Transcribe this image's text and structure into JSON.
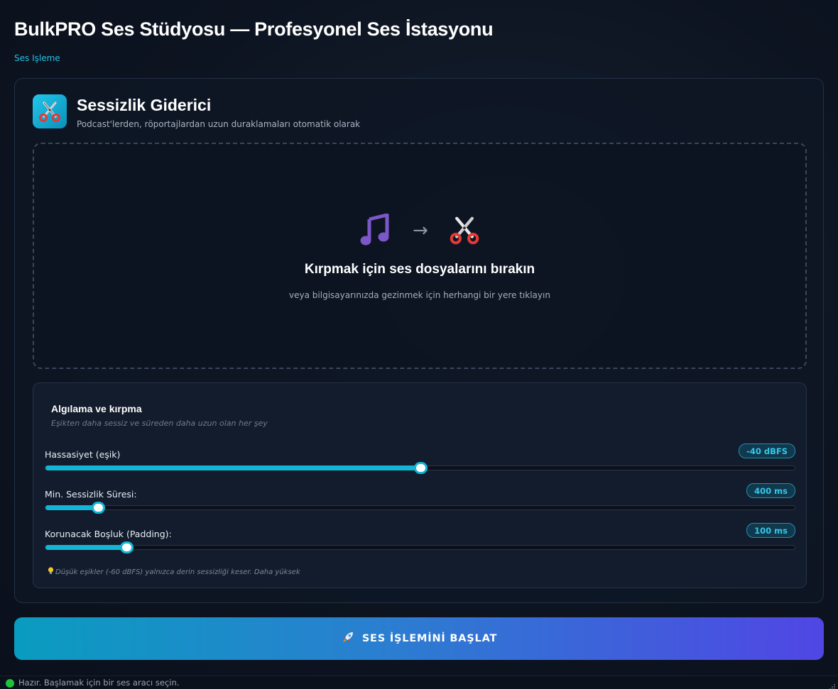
{
  "app": {
    "title": "BulkPRO Ses Stüdyosu — Profesyonel Ses İstasyonu",
    "breadcrumb": "Ses Işleme"
  },
  "tool": {
    "icon": "scissors-icon",
    "title": "Sessizlik Giderici",
    "subtitle": "Podcast'lerden, röportajlardan uzun duraklamaları otomatik olarak"
  },
  "dropzone": {
    "icons": [
      "music-note-icon",
      "arrow-right-icon",
      "scissors-icon"
    ],
    "arrow": "→",
    "title": "Kırpmak için ses dosyalarını bırakın",
    "subtitle": "veya bilgisayarınızda gezinmek için herhangi bir yere tıklayın"
  },
  "settings": {
    "title": "Algılama ve kırpma",
    "subtitle": "Eşikten daha sessiz ve süreden daha uzun olan her şey",
    "sliders": [
      {
        "label": "Hassasiyet (eşik)",
        "value": "-40 dBFS",
        "fraction": 0.5
      },
      {
        "label": "Min. Sessizlik Süresi:",
        "value": "400 ms",
        "fraction": 0.07
      },
      {
        "label": "Korunacak Boşluk (Padding):",
        "value": "100 ms",
        "fraction": 0.108
      }
    ],
    "hint": "Düşük eşikler (-60 dBFS) yalnızca derin sessizliği keser. Daha yüksek"
  },
  "action": {
    "icon": "rocket-icon",
    "label": "SES İŞLEMİNİ BAŞLAT"
  },
  "status": {
    "text": "Hazır. Başlamak için bir ses aracı seçin.",
    "color": "#1ec23c"
  },
  "colors": {
    "accent": "#12b5d6",
    "gradient_start": "#0a9cc0",
    "gradient_end": "#5046e4"
  }
}
